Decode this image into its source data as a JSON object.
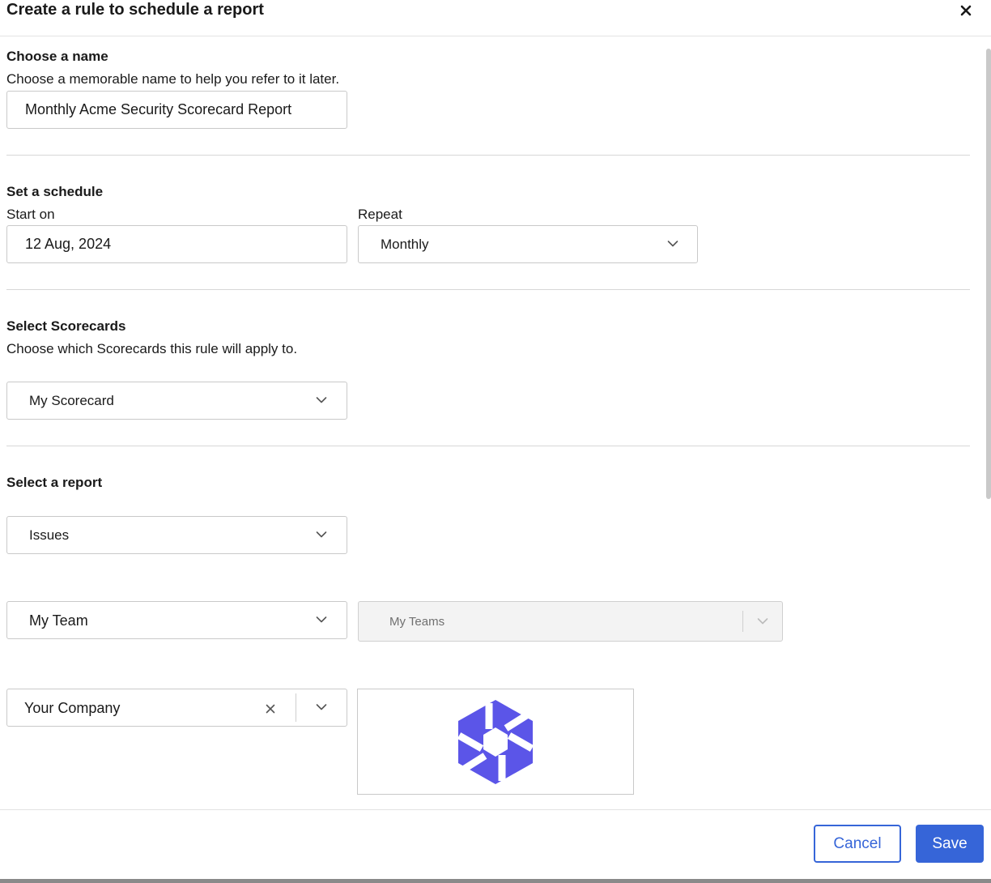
{
  "modal": {
    "title": "Create a rule to schedule a report"
  },
  "name_section": {
    "title": "Choose a name",
    "description": "Choose a memorable name to help you refer to it later.",
    "value": "Monthly Acme Security Scorecard Report"
  },
  "schedule_section": {
    "title": "Set a schedule",
    "start_label": "Start on",
    "start_value": "12 Aug, 2024",
    "repeat_label": "Repeat",
    "repeat_value": "Monthly"
  },
  "scorecards_section": {
    "title": "Select Scorecards",
    "description": "Choose which Scorecards this rule will apply to.",
    "value": "My Scorecard"
  },
  "report_section": {
    "title": "Select a report",
    "report_type": "Issues",
    "team_type": "My Team",
    "teams_placeholder": "My Teams",
    "company_value": "Your Company"
  },
  "footer": {
    "cancel_label": "Cancel",
    "save_label": "Save"
  },
  "icons": {
    "close": "close-icon",
    "chevron": "chevron-down-icon",
    "clear": "clear-icon",
    "logo": "company-logo"
  },
  "colors": {
    "primary": "#3665d8",
    "logo": "#5b55e8",
    "border": "#c9c9c9"
  }
}
